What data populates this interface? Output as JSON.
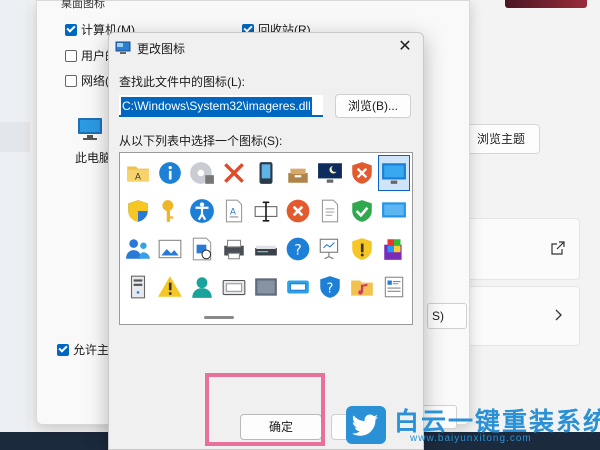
{
  "background": {
    "groupbox_title": "桌面图标",
    "checkboxes": [
      {
        "label": "计算机(M)",
        "checked": true
      },
      {
        "label": "回收站(R)",
        "checked": true
      },
      {
        "label": "用户的",
        "checked": false
      },
      {
        "label": "网络(",
        "checked": false
      }
    ],
    "desktop_icon_label": "此电脑",
    "allow_theme_label": "允许主",
    "restore_button_partial": "S)",
    "browse_themes_button": "浏览主题",
    "external_link_icon": "external-link-icon",
    "chevron_icon": "chevron-right-icon"
  },
  "dialog": {
    "title": "更改图标",
    "close_glyph": "✕",
    "find_label": "查找此文件中的图标(L):",
    "file_path": "C:\\Windows\\System32\\imageres.dll",
    "browse_button": "浏览(B)...",
    "list_label": "从以下列表中选择一个图标(S):",
    "ok_button": "确定",
    "icons": [
      [
        "folder-a-icon",
        "info-icon",
        "cd-drive-icon",
        "red-x-icon",
        "phone-device-icon",
        "drive-box-icon",
        "monitor-moon-icon",
        "shield-x-icon",
        "monitor-selected-icon"
      ],
      [
        "shield-uac-icon",
        "key-icon",
        "accessibility-icon",
        "document-a-icon",
        "textbox-icon",
        "error-circle-icon",
        "blank-page-icon",
        "shield-check-icon",
        "screen-blue-icon"
      ],
      [
        "users-icon",
        "picture-icon",
        "doc-picture-icon",
        "printer-small-icon",
        "scanner-icon",
        "help-circle-icon",
        "projector-icon",
        "warning-shield-icon",
        "windows-install-icon"
      ],
      [
        "server-tower-icon",
        "warning-triangle-icon",
        "user-icon",
        "card-reader-icon",
        "hard-drive-icon",
        "monitor-disk-icon",
        "shield-question-icon",
        "music-folder-icon",
        "document-list-icon"
      ]
    ],
    "selected_icon": "monitor-selected-icon"
  },
  "watermark": {
    "title": "白云一键重装系统",
    "url": "www.baiyunxitong.com"
  }
}
